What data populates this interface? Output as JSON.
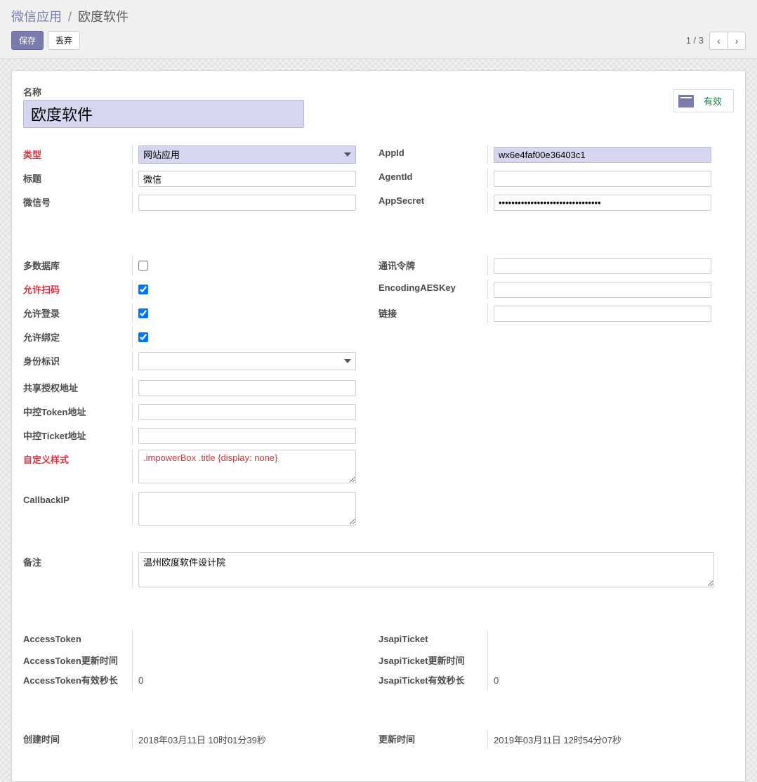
{
  "breadcrumb": {
    "root": "微信应用",
    "current": "欧度软件"
  },
  "toolbar": {
    "save": "保存",
    "discard": "丢弃"
  },
  "pager": {
    "pos": "1 / 3"
  },
  "status": {
    "label": "有效"
  },
  "name": {
    "label": "名称",
    "value": "欧度软件"
  },
  "left": {
    "type_label": "类型",
    "type_value": "网站应用",
    "title_label": "标题",
    "title_value": "微信",
    "wxid_label": "微信号",
    "wxid_value": ""
  },
  "right": {
    "appid_label": "AppId",
    "appid_value": "wx6e4faf00e36403c1",
    "agentid_label": "AgentId",
    "agentid_value": "",
    "appsecret_label": "AppSecret",
    "appsecret_value": "••••••••••••••••••••••••••••••••"
  },
  "left2": {
    "multidb_label": "多数据库",
    "scan_label": "允许扫码",
    "login_label": "允许登录",
    "bind_label": "允许绑定",
    "identity_label": "身份标识",
    "identity_value": "",
    "share_auth_label": "共享授权地址",
    "share_auth_value": "",
    "token_url_label": "中控Token地址",
    "token_url_value": "",
    "ticket_url_label": "中控Ticket地址",
    "ticket_url_value": "",
    "custom_css_label": "自定义样式",
    "custom_css_value": ".impowerBox .title {display: none}",
    "callbackip_label": "CallbackIP",
    "callbackip_value": ""
  },
  "right2": {
    "comm_token_label": "通讯令牌",
    "comm_token_value": "",
    "aeskey_label": "EncodingAESKey",
    "aeskey_value": "",
    "link_label": "链接",
    "link_value": ""
  },
  "remark": {
    "label": "备注",
    "value": "温州欧度软件设计院"
  },
  "tokens": {
    "at_label": "AccessToken",
    "at_update_label": "AccessToken更新时间",
    "at_ttl_label": "AccessToken有效秒长",
    "at_ttl_value": "0",
    "jt_label": "JsapiTicket",
    "jt_update_label": "JsapiTicket更新时间",
    "jt_ttl_label": "JsapiTicket有效秒长",
    "jt_ttl_value": "0"
  },
  "times": {
    "create_label": "创建时间",
    "create_value": "2018年03月11日 10时01分39秒",
    "update_label": "更新时间",
    "update_value": "2019年03月11日 12时54分07秒"
  }
}
